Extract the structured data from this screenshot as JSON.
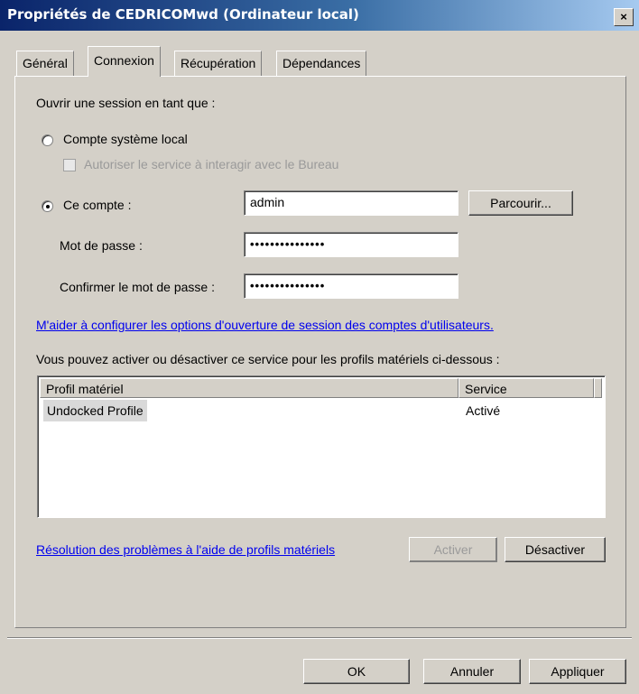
{
  "window": {
    "title": "Propriétés de CEDRICOMwd (Ordinateur local)",
    "close_glyph": "×"
  },
  "tabs": [
    {
      "label": "Général",
      "active": false
    },
    {
      "label": "Connexion",
      "active": true
    },
    {
      "label": "Récupération",
      "active": false
    },
    {
      "label": "Dépendances",
      "active": false
    }
  ],
  "logon": {
    "heading": "Ouvrir une session en tant que :",
    "local_system_label": "Compte système local",
    "local_system_selected": false,
    "desktop_interact_label": "Autoriser le service à interagir avec le Bureau",
    "desktop_interact_checked": false,
    "this_account_label": "Ce compte :",
    "this_account_selected": true,
    "account_value": "admin",
    "browse_label": "Parcourir...",
    "password_label": "Mot de passe :",
    "password_value": "•••••••••••••••",
    "confirm_label": "Confirmer le mot de passe :",
    "confirm_value": "•••••••••••••••"
  },
  "help_link": "M'aider à configurer les options d'ouverture de session des comptes d'utilisateurs.",
  "hardware": {
    "intro": "Vous pouvez activer ou désactiver ce service pour les profils matériels ci-dessous :",
    "columns": [
      "Profil matériel",
      "Service"
    ],
    "rows": [
      {
        "profile": "Undocked Profile",
        "service": "Activé"
      }
    ],
    "troubleshoot_link": "Résolution des problèmes à l'aide de profils matériels",
    "enable_label": "Activer",
    "disable_label": "Désactiver"
  },
  "footer": {
    "ok": "OK",
    "cancel": "Annuler",
    "apply": "Appliquer"
  }
}
